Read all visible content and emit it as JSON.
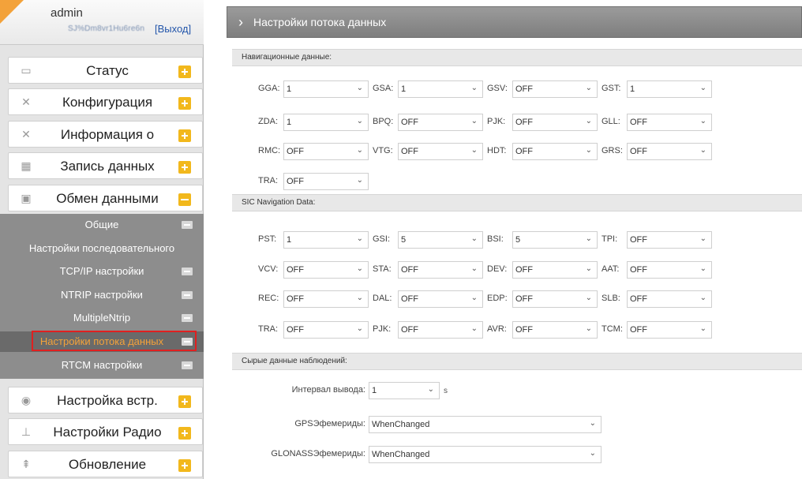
{
  "user": {
    "name": "admin",
    "id": "SJ%Dm8vr1Hu6re6n",
    "logout": "[Выход]"
  },
  "menu": [
    {
      "label": "Статус",
      "icon": "monitor-icon"
    },
    {
      "label": "Конфигурация",
      "icon": "wrench-icon"
    },
    {
      "label": "Информация о",
      "icon": "satellite-icon"
    },
    {
      "label": "Запись данных",
      "icon": "calendar-icon"
    },
    {
      "label": "Обмен данными",
      "icon": "computer-icon"
    },
    {
      "label": "Настройка встр.",
      "icon": "globe-icon"
    },
    {
      "label": "Настройки Радио",
      "icon": "antenna-icon"
    },
    {
      "label": "Обновление",
      "icon": "upload-icon"
    }
  ],
  "submenu": [
    {
      "label": "Общие"
    },
    {
      "label": "Настройки последовательного"
    },
    {
      "label": "TCP/IP настройки"
    },
    {
      "label": "NTRIP настройки"
    },
    {
      "label": "MultipleNtrip"
    },
    {
      "label": "Настройки потока данных"
    },
    {
      "label": "RTCM настройки"
    }
  ],
  "page_title": "Настройки потока данных",
  "sections": {
    "nav": "Навигационные данные:",
    "sic": "SIC Navigation Data:",
    "raw": "Сырые данные наблюдений:"
  },
  "nav_fields": [
    {
      "label": "GGA:",
      "value": "1"
    },
    {
      "label": "GSA:",
      "value": "1"
    },
    {
      "label": "GSV:",
      "value": "OFF"
    },
    {
      "label": "GST:",
      "value": "1"
    },
    {
      "label": "ZDA:",
      "value": "1"
    },
    {
      "label": "BPQ:",
      "value": "OFF"
    },
    {
      "label": "PJK:",
      "value": "OFF"
    },
    {
      "label": "GLL:",
      "value": "OFF"
    },
    {
      "label": "RMC:",
      "value": "OFF"
    },
    {
      "label": "VTG:",
      "value": "OFF"
    },
    {
      "label": "HDT:",
      "value": "OFF"
    },
    {
      "label": "GRS:",
      "value": "OFF"
    },
    {
      "label": "TRA:",
      "value": "OFF"
    }
  ],
  "sic_fields": [
    {
      "label": "PST:",
      "value": "1"
    },
    {
      "label": "GSI:",
      "value": "5"
    },
    {
      "label": "BSI:",
      "value": "5"
    },
    {
      "label": "TPI:",
      "value": "OFF"
    },
    {
      "label": "VCV:",
      "value": "OFF"
    },
    {
      "label": "STA:",
      "value": "OFF"
    },
    {
      "label": "DEV:",
      "value": "OFF"
    },
    {
      "label": "AAT:",
      "value": "OFF"
    },
    {
      "label": "REC:",
      "value": "OFF"
    },
    {
      "label": "DAL:",
      "value": "OFF"
    },
    {
      "label": "EDP:",
      "value": "OFF"
    },
    {
      "label": "SLB:",
      "value": "OFF"
    },
    {
      "label": "TRA:",
      "value": "OFF"
    },
    {
      "label": "PJK:",
      "value": "OFF"
    },
    {
      "label": "AVR:",
      "value": "OFF"
    },
    {
      "label": "TCM:",
      "value": "OFF"
    }
  ],
  "raw_fields": {
    "interval_label": "Интервал вывода:",
    "interval_value": "1",
    "interval_unit": "s",
    "gps_label": "GPSЭфемериды:",
    "gps_value": "WhenChanged",
    "glonass_label": "GLONASSЭфемериды:",
    "glonass_value": "WhenChanged"
  }
}
